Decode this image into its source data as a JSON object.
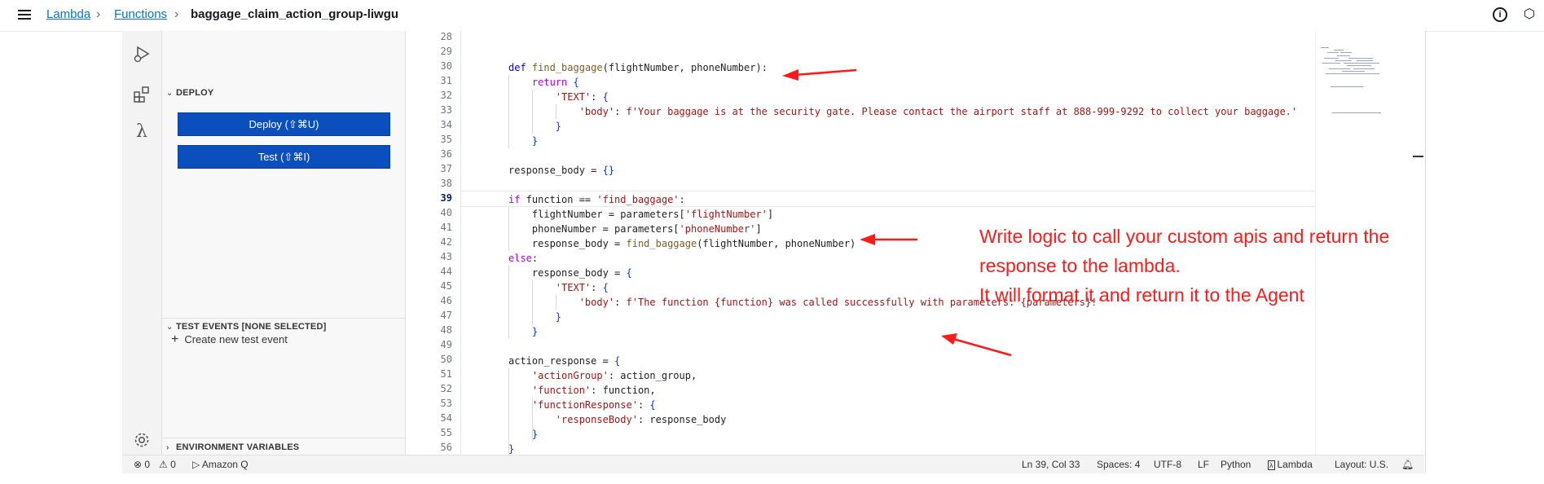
{
  "breadcrumb": {
    "root": "Lambda",
    "functions": "Functions",
    "current": "baggage_claim_action_group-liwgu"
  },
  "sidebar": {
    "deploy_section": "DEPLOY",
    "deploy_button": "Deploy (⇧⌘U)",
    "test_button": "Test (⇧⌘I)",
    "test_events_section": "TEST EVENTS [NONE SELECTED]",
    "create_test_event": "Create new test event",
    "env_vars_section": "ENVIRONMENT VARIABLES"
  },
  "editor": {
    "line_numbers": [
      "28",
      "29",
      "30",
      "31",
      "32",
      "33",
      "34",
      "35",
      "36",
      "37",
      "38",
      "39",
      "40",
      "41",
      "42",
      "43",
      "44",
      "45",
      "46",
      "47",
      "48",
      "49",
      "50",
      "51",
      "52",
      "53",
      "54",
      "55",
      "56"
    ],
    "active_line": "39",
    "code_lines": [
      "",
      "",
      "def find_baggage(flightNumber, phoneNumber):",
      "    return {",
      "        'TEXT': {",
      "            'body': f'Your baggage is at the security gate. Please contact the airport staff at 888-999-9292 to collect your baggage.'",
      "        }",
      "    }",
      "",
      "response_body = {}",
      "",
      "if function == 'find_baggage':",
      "    flightNumber = parameters['flightNumber']",
      "    phoneNumber = parameters['phoneNumber']",
      "    response_body = find_baggage(flightNumber, phoneNumber)",
      "else:",
      "    response_body = {",
      "        'TEXT': {",
      "            'body': f'The function {function} was called successfully with parameters: {parameters}!'",
      "        }",
      "    }",
      "",
      "action_response = {",
      "    'actionGroup': action_group,",
      "    'function': function,",
      "    'functionResponse': {",
      "        'responseBody': response_body",
      "    }",
      "}"
    ]
  },
  "statusbar": {
    "errors": "⊗ 0",
    "warnings": "⚠ 0",
    "amazon_q": "Amazon Q",
    "position": "Ln 39, Col 33",
    "spaces": "Spaces: 4",
    "encoding": "UTF-8",
    "eol": "LF",
    "language": "Python",
    "lambda": "Lambda",
    "layout": "Layout: U.S."
  },
  "annotation": {
    "line1": "Write logic to call your custom apis and return the",
    "line2": "response to the lambda.",
    "line3": "It will format it and return it to the Agent",
    "color": "#ff1a1a"
  },
  "colors": {
    "deploy_button": "#0b4fbe",
    "link": "#0972d3"
  },
  "icons": [
    "hamburger-icon",
    "info-icon",
    "cloudshell-icon",
    "run-debug-icon",
    "extensions-icon",
    "lambda-icon",
    "settings-icon",
    "bell-icon"
  ]
}
